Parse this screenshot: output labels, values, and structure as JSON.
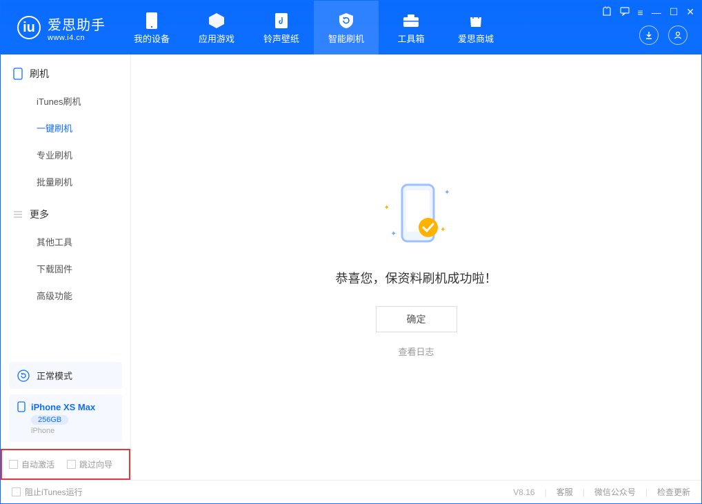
{
  "header": {
    "logo_title": "爱思助手",
    "logo_sub": "www.i4.cn",
    "nav": [
      {
        "label": "我的设备"
      },
      {
        "label": "应用游戏"
      },
      {
        "label": "铃声壁纸"
      },
      {
        "label": "智能刷机"
      },
      {
        "label": "工具箱"
      },
      {
        "label": "爱思商城"
      }
    ]
  },
  "sidebar": {
    "section1_title": "刷机",
    "section1_items": [
      "iTunes刷机",
      "一键刷机",
      "专业刷机",
      "批量刷机"
    ],
    "section2_title": "更多",
    "section2_items": [
      "其他工具",
      "下载固件",
      "高级功能"
    ],
    "mode_label": "正常模式",
    "device_name": "iPhone XS Max",
    "device_capacity": "256GB",
    "device_type": "iPhone",
    "checkbox1": "自动激活",
    "checkbox2": "跳过向导"
  },
  "main": {
    "success_text": "恭喜您，保资料刷机成功啦！",
    "ok_button": "确定",
    "log_link": "查看日志"
  },
  "footer": {
    "block_itunes": "阻止iTunes运行",
    "version": "V8.16",
    "links": [
      "客服",
      "微信公众号",
      "检查更新"
    ]
  },
  "colors": {
    "primary": "#0d6efd",
    "accent": "#ffb300",
    "highlight_border": "#e53935"
  }
}
